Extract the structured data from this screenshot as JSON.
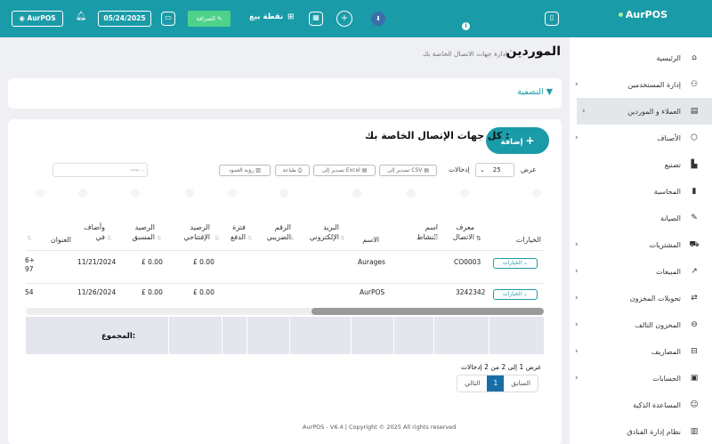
{
  "app": {
    "name": "AurPOS"
  },
  "topbar": {
    "user": "AurPOS",
    "date": "05/24/2025",
    "cash_label": "الصرافة",
    "pos_label": "نقطة بيع"
  },
  "sidebar": {
    "items": [
      {
        "label": "الرئيسية",
        "icon": "home-icon",
        "chevron": false,
        "active": false
      },
      {
        "label": "إدارة المستخدمين",
        "icon": "users-icon",
        "chevron": true,
        "active": false
      },
      {
        "label": "العملاء و الموردين",
        "icon": "address-book-icon",
        "chevron": true,
        "active": true
      },
      {
        "label": "الأصناف",
        "icon": "box-icon",
        "chevron": true,
        "active": false
      },
      {
        "label": "تصنيع",
        "icon": "factory-icon",
        "chevron": false,
        "active": false
      },
      {
        "label": "المحاسبة",
        "icon": "book-icon",
        "chevron": false,
        "active": false
      },
      {
        "label": "الصيانة",
        "icon": "wrench-icon",
        "chevron": false,
        "active": false
      },
      {
        "label": "المشتريات",
        "icon": "cart-icon",
        "chevron": true,
        "active": false
      },
      {
        "label": "المبيعات",
        "icon": "sales-icon",
        "chevron": true,
        "active": false
      },
      {
        "label": "تحويلات المخزون",
        "icon": "transfer-icon",
        "chevron": true,
        "active": false
      },
      {
        "label": "المخزون التالف",
        "icon": "damaged-icon",
        "chevron": true,
        "active": false
      },
      {
        "label": "المصاريف",
        "icon": "expenses-icon",
        "chevron": true,
        "active": false
      },
      {
        "label": "الحسابات",
        "icon": "accounts-icon",
        "chevron": true,
        "active": false
      },
      {
        "label": "المساعدة الذكية",
        "icon": "robot-icon",
        "chevron": false,
        "active": false
      },
      {
        "label": "نظام إدارة الفنادق",
        "icon": "hotel-icon",
        "chevron": false,
        "active": false
      }
    ]
  },
  "page": {
    "title": "الموردين",
    "subtitle": "إدارة جهات الاتصال الخاصة بك",
    "filter_label": "التصفية",
    "list_title": "كل جهات الإتصال الخاصة بك :",
    "add_button": "إضافة"
  },
  "toolbar": {
    "show_label": "عرض",
    "show_value": "25",
    "entries_label": "إدخالات",
    "csv_label": "تصدير إلى CSV",
    "excel_label": "تصدير إلى Excel",
    "print_label": "طباعة",
    "columns_label": "رؤية العمود",
    "search_placeholder": "بحث ..."
  },
  "table": {
    "headers": {
      "options": "الخيارات",
      "contact_id": "معرف الاتصال",
      "business": "اسم النشاط",
      "name": "الاسم",
      "email": "البريد الإلكتروني",
      "tax": "الرقم الضريبي",
      "pay_term": "فترة الدفع",
      "opening_balance": "الرصيد الإفتتاحي",
      "advance_balance": "الرصيد المسبق",
      "added_on": "وأضاف في",
      "address": "العنوان"
    },
    "rows": [
      {
        "options": "الخيارات",
        "contact_id": "CO0003",
        "name": "Aurages",
        "opening": "£ 0.00",
        "advance": "£ 0.00",
        "added_on": "11/21/2024",
        "address": "6+ 97"
      },
      {
        "options": "الخيارات",
        "contact_id": "3242342",
        "name": "AurPOS",
        "opening": "£ 0.00",
        "advance": "£ 0.00",
        "added_on": "11/26/2024",
        "address": "54"
      }
    ],
    "total_label": "المجموع:"
  },
  "pagination": {
    "info": "عرض 1 إلى 2 من 2 إدخالات",
    "prev": "السابق",
    "page": "1",
    "next": "التالي"
  },
  "footer": {
    "copyright": "AurPOS - V6.4 | Copyright © 2025 All rights reserved"
  }
}
